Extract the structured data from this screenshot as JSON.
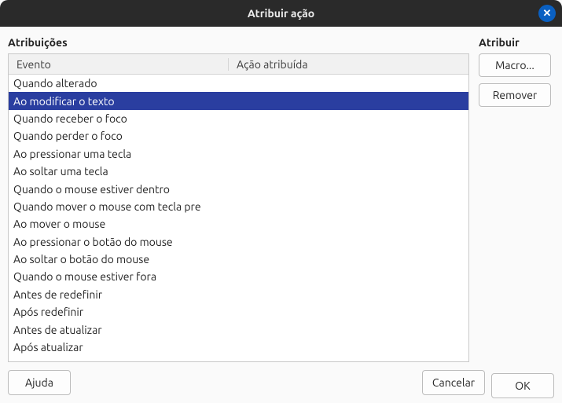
{
  "titlebar": {
    "title": "Atribuir ação"
  },
  "assignments": {
    "section_label": "Atribuições",
    "columns": {
      "event": "Evento",
      "action": "Ação atribuída"
    },
    "rows": [
      {
        "event": "Quando alterado",
        "action": "",
        "selected": false
      },
      {
        "event": "Ao modificar o texto",
        "action": "",
        "selected": true
      },
      {
        "event": "Quando receber o foco",
        "action": "",
        "selected": false
      },
      {
        "event": "Quando perder o foco",
        "action": "",
        "selected": false
      },
      {
        "event": "Ao pressionar uma tecla",
        "action": "",
        "selected": false
      },
      {
        "event": "Ao soltar uma tecla",
        "action": "",
        "selected": false
      },
      {
        "event": "Quando o mouse estiver dentro",
        "action": "",
        "selected": false
      },
      {
        "event": "Quando mover o mouse com tecla pre",
        "action": "",
        "selected": false
      },
      {
        "event": "Ao mover o mouse",
        "action": "",
        "selected": false
      },
      {
        "event": "Ao pressionar o botão do mouse",
        "action": "",
        "selected": false
      },
      {
        "event": "Ao soltar o botão do mouse",
        "action": "",
        "selected": false
      },
      {
        "event": "Quando o mouse estiver fora",
        "action": "",
        "selected": false
      },
      {
        "event": "Antes de redefinir",
        "action": "",
        "selected": false
      },
      {
        "event": "Após redefinir",
        "action": "",
        "selected": false
      },
      {
        "event": "Antes de atualizar",
        "action": "",
        "selected": false
      },
      {
        "event": "Após atualizar",
        "action": "",
        "selected": false
      }
    ]
  },
  "assign": {
    "section_label": "Atribuir",
    "macro_label": "Macro...",
    "remove_label": "Remover"
  },
  "footer": {
    "help_label": "Ajuda",
    "cancel_label": "Cancelar",
    "ok_label": "OK"
  }
}
